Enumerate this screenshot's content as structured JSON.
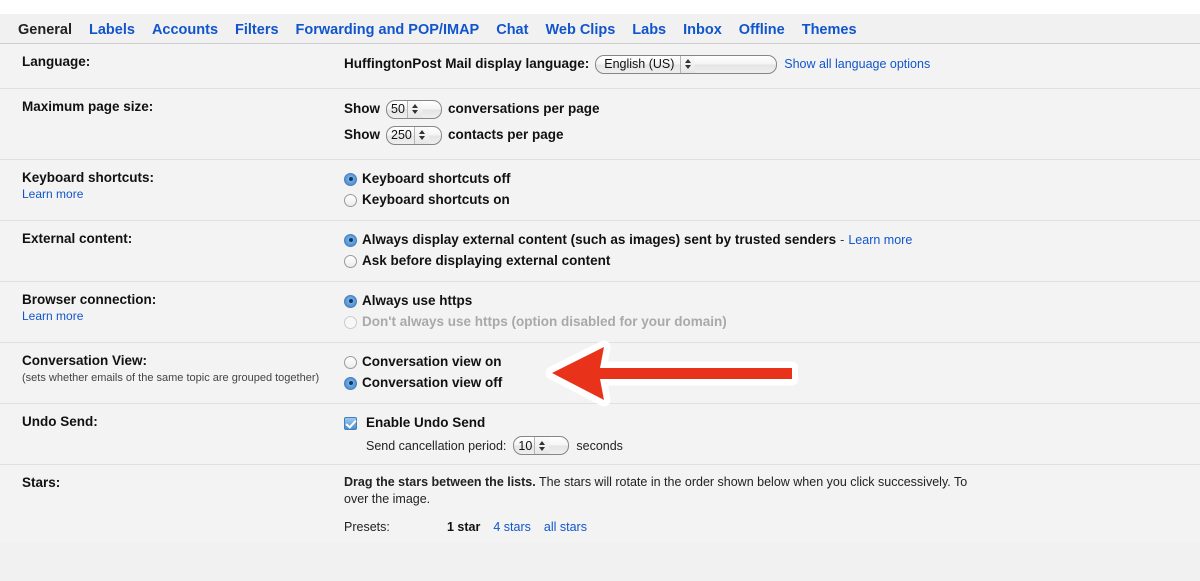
{
  "tabs": [
    {
      "label": "General",
      "active": true
    },
    {
      "label": "Labels",
      "active": false
    },
    {
      "label": "Accounts",
      "active": false
    },
    {
      "label": "Filters",
      "active": false
    },
    {
      "label": "Forwarding and POP/IMAP",
      "active": false
    },
    {
      "label": "Chat",
      "active": false
    },
    {
      "label": "Web Clips",
      "active": false
    },
    {
      "label": "Labs",
      "active": false
    },
    {
      "label": "Inbox",
      "active": false
    },
    {
      "label": "Offline",
      "active": false
    },
    {
      "label": "Themes",
      "active": false
    }
  ],
  "language": {
    "label": "Language:",
    "prefix": "HuffingtonPost Mail display language:",
    "value": "English (US)",
    "show_all_link": "Show all language options"
  },
  "page_size": {
    "label": "Maximum page size:",
    "show_word": "Show",
    "conversations_value": "50",
    "conversations_suffix": "conversations per page",
    "contacts_value": "250",
    "contacts_suffix": "contacts per page"
  },
  "keyboard": {
    "label": "Keyboard shortcuts:",
    "learn_more": "Learn more",
    "off_label": "Keyboard shortcuts off",
    "on_label": "Keyboard shortcuts on",
    "selected": "off"
  },
  "external_content": {
    "label": "External content:",
    "always_label": "Always display external content (such as images) sent by trusted senders",
    "always_separator": "-",
    "learn_more": "Learn more",
    "ask_label": "Ask before displaying external content",
    "selected": "always"
  },
  "browser_connection": {
    "label": "Browser connection:",
    "learn_more": "Learn more",
    "https_label": "Always use https",
    "no_https_label": "Don't always use https (option disabled for your domain)",
    "selected": "https"
  },
  "conversation_view": {
    "label": "Conversation View:",
    "sublabel": "(sets whether emails of the same topic are grouped together)",
    "on_label": "Conversation view on",
    "off_label": "Conversation view off",
    "selected": "off",
    "annotation_color": "#e8321a"
  },
  "undo_send": {
    "label": "Undo Send:",
    "enable_label": "Enable Undo Send",
    "enabled": true,
    "period_label": "Send cancellation period:",
    "period_value": "10",
    "period_suffix": "seconds"
  },
  "stars": {
    "label": "Stars:",
    "desc_bold": "Drag the stars between the lists.",
    "desc_rest": "The stars will rotate in the order shown below when you click successively. To",
    "desc_line2": "over the image.",
    "presets_label": "Presets:",
    "preset_active": "1 star",
    "preset_links": [
      "4 stars",
      "all stars"
    ]
  }
}
